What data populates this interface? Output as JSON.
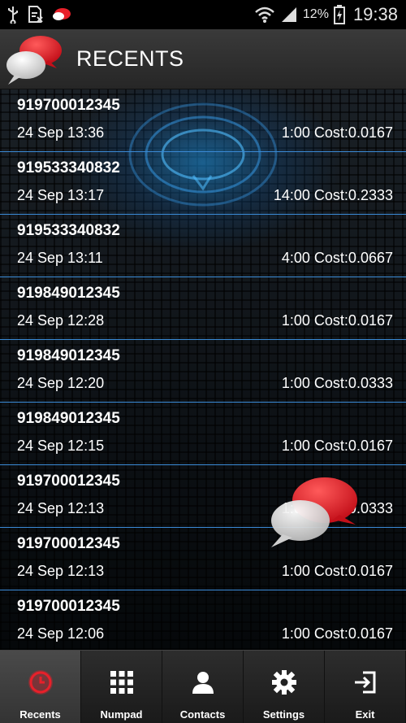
{
  "status_bar": {
    "battery_percent": "12%",
    "time": "19:38"
  },
  "header": {
    "title": "RECENTS"
  },
  "calls": [
    {
      "number": "919700012345",
      "date": "24 Sep  13:36",
      "cost": "1:00 Cost:0.0167"
    },
    {
      "number": "919533340832",
      "date": "24 Sep  13:17",
      "cost": "14:00 Cost:0.2333"
    },
    {
      "number": "919533340832",
      "date": "24 Sep  13:11",
      "cost": "4:00 Cost:0.0667"
    },
    {
      "number": "919849012345",
      "date": "24 Sep  12:28",
      "cost": "1:00 Cost:0.0167"
    },
    {
      "number": "919849012345",
      "date": "24 Sep  12:20",
      "cost": "1:00 Cost:0.0333"
    },
    {
      "number": "919849012345",
      "date": "24 Sep  12:15",
      "cost": "1:00 Cost:0.0167"
    },
    {
      "number": "919700012345",
      "date": "24 Sep  12:13",
      "cost": "1:00 Cost:0.0333"
    },
    {
      "number": "919700012345",
      "date": "24 Sep  12:13",
      "cost": "1:00 Cost:0.0167"
    },
    {
      "number": "919700012345",
      "date": "24 Sep  12:06",
      "cost": "1:00 Cost:0.0167"
    }
  ],
  "nav": {
    "recents": "Recents",
    "numpad": "Numpad",
    "contacts": "Contacts",
    "settings": "Settings",
    "exit": "Exit"
  },
  "colors": {
    "accent_red": "#e8202a",
    "divider_blue": "#3a8ad6",
    "glow_blue": "#1e96e6"
  }
}
